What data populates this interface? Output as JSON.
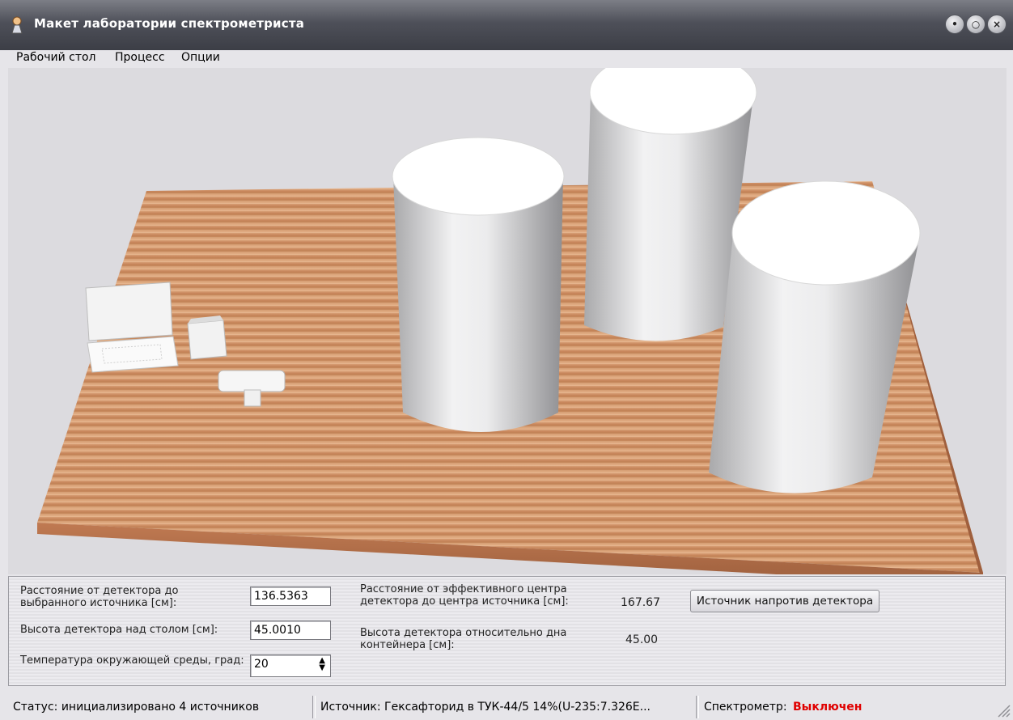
{
  "window": {
    "title": "Макет лаборатории спектрометриста"
  },
  "menu": {
    "items": [
      "Рабочий стол",
      "Процесс",
      "Опции"
    ]
  },
  "controls": {
    "distance_label": "Расстояние от детектора до выбранного источника [см]:",
    "distance_value": "136.5363",
    "height_label": "Высота детектора над столом [см]:",
    "height_value": "45.0010",
    "temperature_label": "Температура окружающей среды, град:",
    "temperature_value": "20",
    "center_distance_label": "Расстояние от эффективного центра детектора до центра источника [см]:",
    "center_distance_value": "167.67",
    "container_height_label": "Высота детектора относительно дна контейнера [см]:",
    "container_height_value": "45.00",
    "source_opposite_button": "Источник напротив детектора"
  },
  "status": {
    "status_text": "Статус: инициализировано 4 источников",
    "source_text": "Источник: Гексафторид в ТУК-44/5 14%(U-235:7.326E...",
    "spectrometer_label": "Спектрометр:",
    "spectrometer_state": "Выключен",
    "state_color": "#e00000"
  },
  "icons": [
    "app-icon",
    "minimize-icon",
    "maximize-icon",
    "close-icon",
    "spin-up-icon",
    "spin-down-icon",
    "resize-grip-icon"
  ]
}
